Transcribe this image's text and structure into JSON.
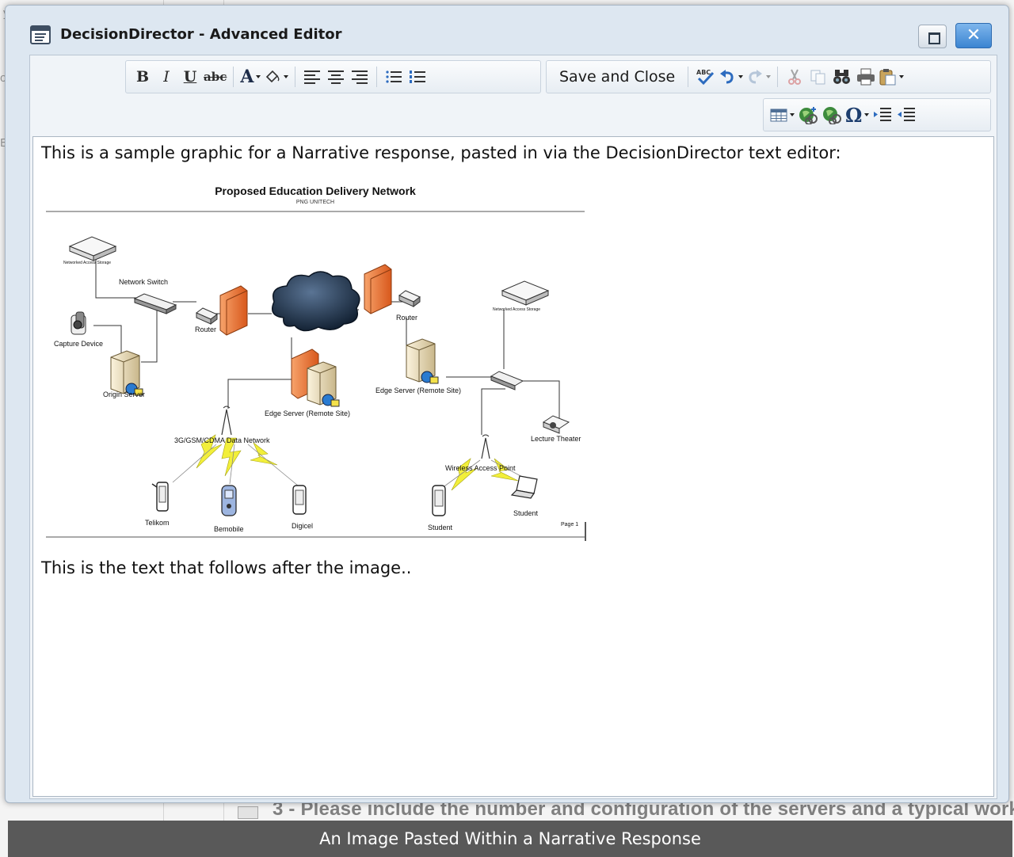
{
  "window": {
    "title": "DecisionDirector - Advanced Editor",
    "maximize_icon": "maximize-icon",
    "close_glyph": "✕"
  },
  "toolbar": {
    "bold": "B",
    "italic": "I",
    "underline": "U",
    "strikethrough": "abc",
    "font_color": "A",
    "save_and_close": "Save and Close",
    "spellcheck": "ABC",
    "special_char": "Ω",
    "icons": [
      "bold-icon",
      "italic-icon",
      "underline-icon",
      "strikethrough-icon",
      "font-color-icon",
      "highlight-color-icon",
      "align-left-icon",
      "align-center-icon",
      "align-right-icon",
      "bulleted-list-icon",
      "numbered-list-icon",
      "spellcheck-icon",
      "undo-icon",
      "redo-icon",
      "cut-icon",
      "copy-icon",
      "find-icon",
      "print-icon",
      "paste-icon",
      "table-icon",
      "insert-link-icon",
      "remove-link-icon",
      "special-character-icon",
      "indent-icon",
      "outdent-icon"
    ]
  },
  "editor": {
    "intro_text": "This is a sample graphic for a Narrative response, pasted in via the DecisionDirector text editor:",
    "after_text": "This is the text that follows after the image.."
  },
  "diagram": {
    "title": "Proposed Education Delivery Network",
    "subtitle": "PNG UNITECH",
    "labels": {
      "nas_left": "Networked Access Storage",
      "network_switch": "Network Switch",
      "capture_device": "Capture Device",
      "router_left": "Router",
      "internet": "Internet",
      "origin_server": "Origin Server",
      "edge_server_center": "Edge Server (Remote Site)",
      "router_right": "Router",
      "nas_right": "Networked Access Storage",
      "edge_server_right": "Edge Server (Remote Site)",
      "lecture_theater": "Lecture Theater",
      "data_network": "3G/GSM/CDMA Data Network",
      "wireless_ap": "Wireless Access Point",
      "telikom": "Telikom",
      "bemobile": "Bemobile",
      "digicel": "Digicel",
      "student_phone": "Student",
      "student_laptop": "Student",
      "page": "Page 1"
    }
  },
  "background": {
    "bottom_text": "3 - Please include the number and configuration of the servers and a typical works",
    "left_letters": [
      "y",
      "or",
      "N",
      "Er",
      "l",
      "ie"
    ]
  },
  "caption": "An Image Pasted Within a Narrative Response",
  "colors": {
    "dialog_bg": "#dde7f1",
    "close_button": "#3b84d1",
    "caption_bg": "#595959",
    "firewall": "#e8732a",
    "cloud": "#1e2f45",
    "lightning": "#f2ef3a"
  }
}
